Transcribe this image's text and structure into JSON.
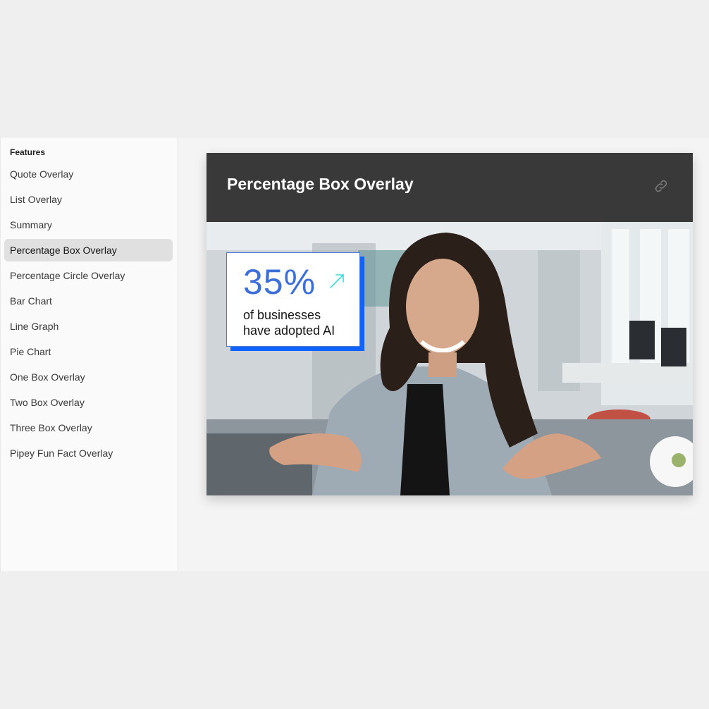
{
  "sidebar": {
    "heading": "Features",
    "items": [
      {
        "label": "Quote Overlay"
      },
      {
        "label": "List Overlay"
      },
      {
        "label": "Summary"
      },
      {
        "label": "Percentage Box Overlay"
      },
      {
        "label": "Percentage Circle Overlay"
      },
      {
        "label": "Bar Chart"
      },
      {
        "label": "Line Graph"
      },
      {
        "label": "Pie Chart"
      },
      {
        "label": "One Box Overlay"
      },
      {
        "label": "Two Box Overlay"
      },
      {
        "label": "Three Box Overlay"
      },
      {
        "label": "Pipey Fun Fact Overlay"
      }
    ],
    "active_index": 3
  },
  "card": {
    "title": "Percentage Box Overlay",
    "link_icon": "link-icon"
  },
  "overlay": {
    "value": "35%",
    "caption_line1": "of businesses",
    "caption_line2": "have adopted AI",
    "arrow_icon": "arrow-up-right-icon"
  },
  "colors": {
    "accent_blue": "#0f62fe",
    "value_blue": "#3d6fd8",
    "header_bg": "#393939",
    "arrow_teal": "#3ddbd9"
  }
}
